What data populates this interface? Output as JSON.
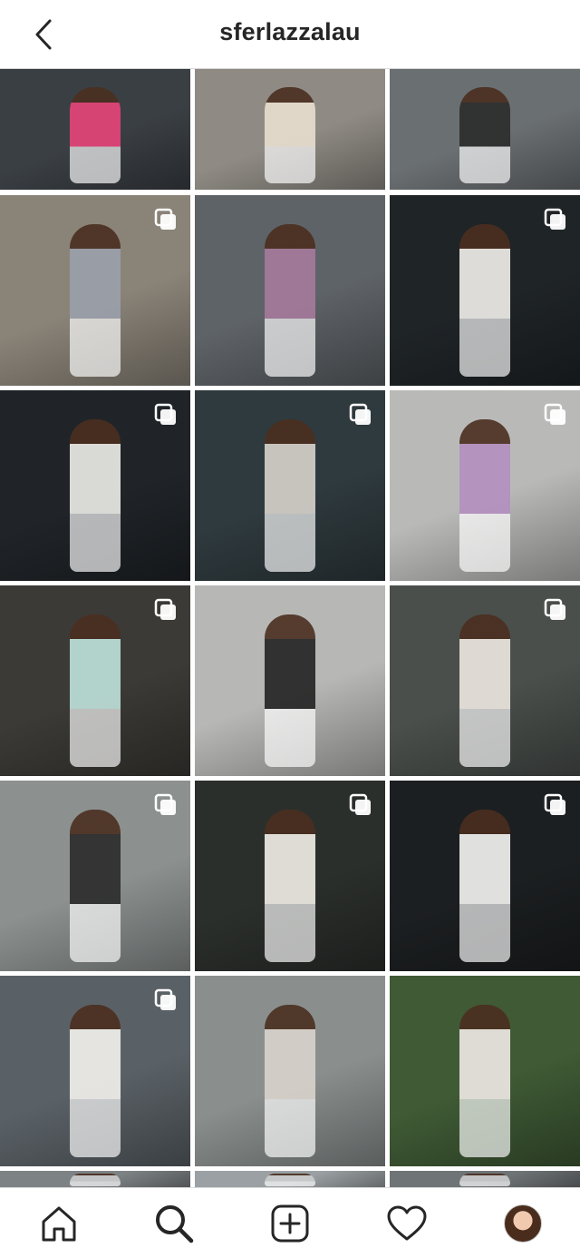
{
  "header": {
    "title": "sferlazzalau",
    "back_icon": "chevron-left-icon"
  },
  "grid": {
    "columns": 3,
    "tiles": [
      {
        "name": "post-1",
        "bg": "#3a3f44",
        "accent": "#e8447a",
        "multi": false
      },
      {
        "name": "post-2",
        "bg": "#8f8b84",
        "accent": "#e9dfcf",
        "multi": false
      },
      {
        "name": "post-3",
        "bg": "#6a6f72",
        "accent": "#2b2b2b",
        "multi": false
      },
      {
        "name": "post-4",
        "bg": "#8a8378",
        "accent": "#9aa0ab",
        "multi": true
      },
      {
        "name": "post-5",
        "bg": "#5e6367",
        "accent": "#a67a9c",
        "multi": false
      },
      {
        "name": "post-6",
        "bg": "#1f2427",
        "accent": "#f3f1ec",
        "multi": true
      },
      {
        "name": "post-7",
        "bg": "#202428",
        "accent": "#eeeeea",
        "multi": true
      },
      {
        "name": "post-8",
        "bg": "#2f3a3e",
        "accent": "#d8d3cc",
        "multi": true
      },
      {
        "name": "post-9",
        "bg": "#b9bab8",
        "accent": "#b48fc0",
        "multi": true
      },
      {
        "name": "post-10",
        "bg": "#3b3a36",
        "accent": "#bfe3dc",
        "multi": true
      },
      {
        "name": "post-11",
        "bg": "#b7b8b6",
        "accent": "#222222",
        "multi": false
      },
      {
        "name": "post-12",
        "bg": "#4a4f4c",
        "accent": "#efeae2",
        "multi": true
      },
      {
        "name": "post-13",
        "bg": "#8c9190",
        "accent": "#2a2a2a",
        "multi": true
      },
      {
        "name": "post-14",
        "bg": "#2b2f2c",
        "accent": "#f2efe8",
        "multi": true
      },
      {
        "name": "post-15",
        "bg": "#1c1f21",
        "accent": "#f6f6f4",
        "multi": true
      },
      {
        "name": "post-16",
        "bg": "#5a6166",
        "accent": "#f4f2ee",
        "multi": true
      },
      {
        "name": "post-17",
        "bg": "#8a8f8e",
        "accent": "#d9d4cc",
        "multi": false
      },
      {
        "name": "post-18",
        "bg": "#3f5a35",
        "accent": "#f0ebe6",
        "multi": false
      },
      {
        "name": "post-19",
        "bg": "#7d8285",
        "accent": "#cccccc",
        "multi": false
      },
      {
        "name": "post-20",
        "bg": "#9aa0a3",
        "accent": "#cccccc",
        "multi": false
      },
      {
        "name": "post-21",
        "bg": "#6f7477",
        "accent": "#cccccc",
        "multi": false
      }
    ]
  },
  "tabbar": {
    "items": [
      {
        "name": "tab-home",
        "icon": "home-icon"
      },
      {
        "name": "tab-search",
        "icon": "search-icon"
      },
      {
        "name": "tab-create",
        "icon": "plus-square-icon"
      },
      {
        "name": "tab-activity",
        "icon": "heart-icon"
      },
      {
        "name": "tab-profile",
        "icon": "profile-avatar"
      }
    ]
  }
}
